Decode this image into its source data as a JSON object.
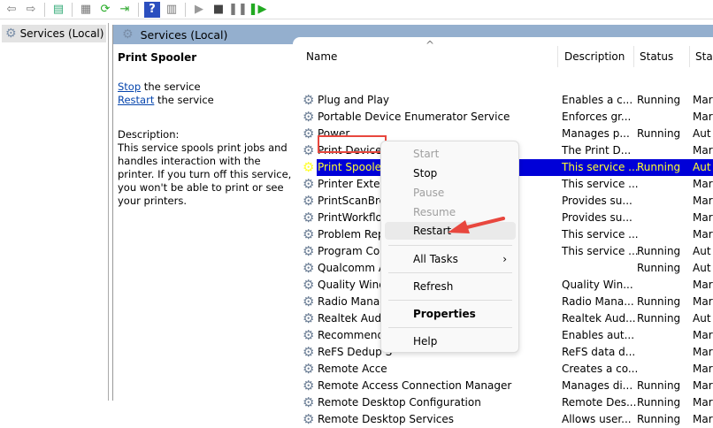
{
  "toolbar": {
    "icons": [
      "back-icon",
      "forward-icon",
      "show-hide-console-tree-icon",
      "properties-icon",
      "refresh-icon",
      "export-list-icon",
      "help-icon",
      "show-action-pane-icon",
      "start-service-icon",
      "stop-service-icon",
      "pause-service-icon",
      "resume-service-icon"
    ]
  },
  "tree": {
    "item": "Services (Local)"
  },
  "main": {
    "header": "Services (Local)"
  },
  "detail": {
    "title": "Print Spooler",
    "stop_link": "Stop",
    "stop_rest": " the service",
    "restart_link": "Restart",
    "restart_rest": " the service",
    "desc_label": "Description:",
    "desc": "This service spools print jobs and handles interaction with the printer. If you turn off this service, you won't be able to print or see your printers."
  },
  "columns": {
    "name": "Name",
    "description": "Description",
    "status": "Status",
    "startup": "Star"
  },
  "rows": [
    {
      "name": "Plug and Play",
      "desc": "Enables a c...",
      "status": "Running",
      "startup": "Mar"
    },
    {
      "name": "Portable Device Enumerator Service",
      "desc": "Enforces gr...",
      "status": "",
      "startup": "Mar"
    },
    {
      "name": "Power",
      "desc": "Manages p...",
      "status": "Running",
      "startup": "Aut"
    },
    {
      "name": "Print Device Configuration Service",
      "desc": "The Print D...",
      "status": "",
      "startup": "Mar"
    },
    {
      "name": "Print Spooler",
      "desc": "This service ...",
      "status": "Running",
      "startup": "Aut"
    },
    {
      "name": "Printer Extens",
      "desc": "This service ...",
      "status": "",
      "startup": "Mar"
    },
    {
      "name": "PrintScanBro",
      "desc": "Provides su...",
      "status": "",
      "startup": "Mar"
    },
    {
      "name": "PrintWorkflo",
      "desc": "Provides su...",
      "status": "",
      "startup": "Mar"
    },
    {
      "name": "Problem Rep",
      "desc": "This service ...",
      "status": "",
      "startup": "Mar"
    },
    {
      "name": "Program Cor",
      "desc": "This service ...",
      "status": "Running",
      "startup": "Aut"
    },
    {
      "name": "Qualcomm A",
      "desc": "",
      "status": "Running",
      "startup": "Aut"
    },
    {
      "name": "Quality Wind",
      "desc": "Quality Win...",
      "status": "",
      "startup": "Mar"
    },
    {
      "name": "Radio Manag",
      "desc": "Radio Mana...",
      "status": "Running",
      "startup": "Mar"
    },
    {
      "name": "Realtek Audi",
      "desc": "Realtek Aud...",
      "status": "Running",
      "startup": "Aut"
    },
    {
      "name": "Recommend",
      "desc": "Enables aut...",
      "status": "",
      "startup": "Mar"
    },
    {
      "name": "ReFS Dedup S",
      "desc": "ReFS data d...",
      "status": "",
      "startup": "Mar"
    },
    {
      "name": "Remote Acce",
      "desc": "Creates a co...",
      "status": "",
      "startup": "Mar"
    },
    {
      "name": "Remote Access Connection Manager",
      "desc": "Manages di...",
      "status": "Running",
      "startup": "Mar"
    },
    {
      "name": "Remote Desktop Configuration",
      "desc": "Remote Des...",
      "status": "Running",
      "startup": "Mar"
    },
    {
      "name": "Remote Desktop Services",
      "desc": "Allows user...",
      "status": "Running",
      "startup": "Mar"
    }
  ],
  "menu": {
    "start": "Start",
    "stop": "Stop",
    "pause": "Pause",
    "resume": "Resume",
    "restart": "Restart",
    "all_tasks": "All Tasks",
    "refresh": "Refresh",
    "properties": "Properties",
    "help": "Help"
  },
  "colors": {
    "selection": "#0000d8",
    "selection_text": "#ffff30",
    "header_bar": "#94afce",
    "annotation": "#e8473e"
  }
}
